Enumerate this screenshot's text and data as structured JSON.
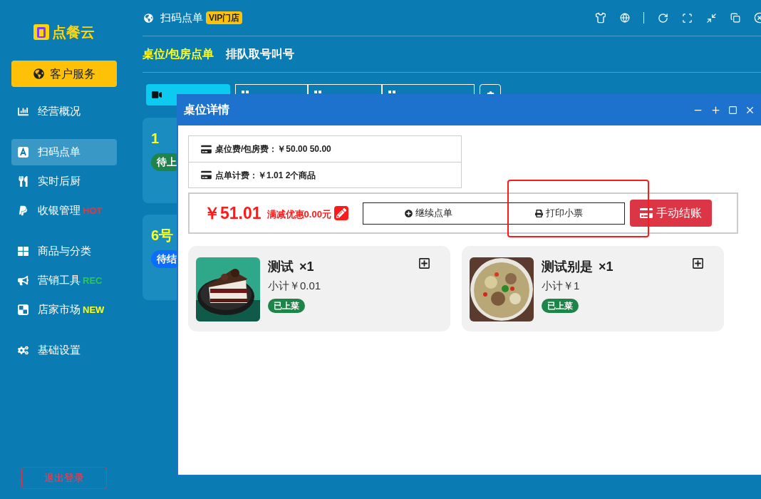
{
  "logo": {
    "text": "点餐云"
  },
  "sidebar": {
    "service_button": "客户服务",
    "groups": [
      [
        {
          "label": "经营概况",
          "selected": false
        }
      ],
      [
        {
          "label": "扫码点单",
          "selected": true
        },
        {
          "label": "实时后厨",
          "selected": false
        },
        {
          "label": "收银管理",
          "selected": false,
          "badge": "HOT",
          "color": "#ff2d2d"
        }
      ],
      [
        {
          "label": "商品与分类",
          "selected": false
        },
        {
          "label": "营销工具",
          "selected": false,
          "badge": "REC",
          "color": "#2ecc40"
        },
        {
          "label": "店家市场",
          "selected": false,
          "badge": "NEW",
          "color": "#ffff1a"
        }
      ],
      [
        {
          "label": "基础设置",
          "selected": false
        }
      ]
    ],
    "logout": "退出登录"
  },
  "header": {
    "title": "扫码点单",
    "badge": "VIP门店"
  },
  "tabs": [
    {
      "label": "桌位/包房点单",
      "selected": true
    },
    {
      "label": "排队取号叫号",
      "selected": false
    }
  ],
  "tables": [
    {
      "number": "1",
      "status": "待上",
      "color": "#1e8449"
    },
    {
      "number": "6号",
      "status": "待结",
      "color": "#0d6efd"
    }
  ],
  "dialog": {
    "title": "桌位详情",
    "fees": [
      "桌位费/包房费：￥50.00 50.00",
      "点单计费：￥1.01 2个商品"
    ],
    "total": "￥51.01",
    "discount": "满减优惠0.00元",
    "buttons": [
      "继续点单",
      "打印小票",
      "手动结账"
    ],
    "items": [
      {
        "name": "测试",
        "qty": "×1",
        "subtotal": "小计￥0.01",
        "status": "已上菜"
      },
      {
        "name": "测试别是",
        "qty": "×1",
        "subtotal": "小计￥1",
        "status": "已上菜"
      }
    ]
  }
}
